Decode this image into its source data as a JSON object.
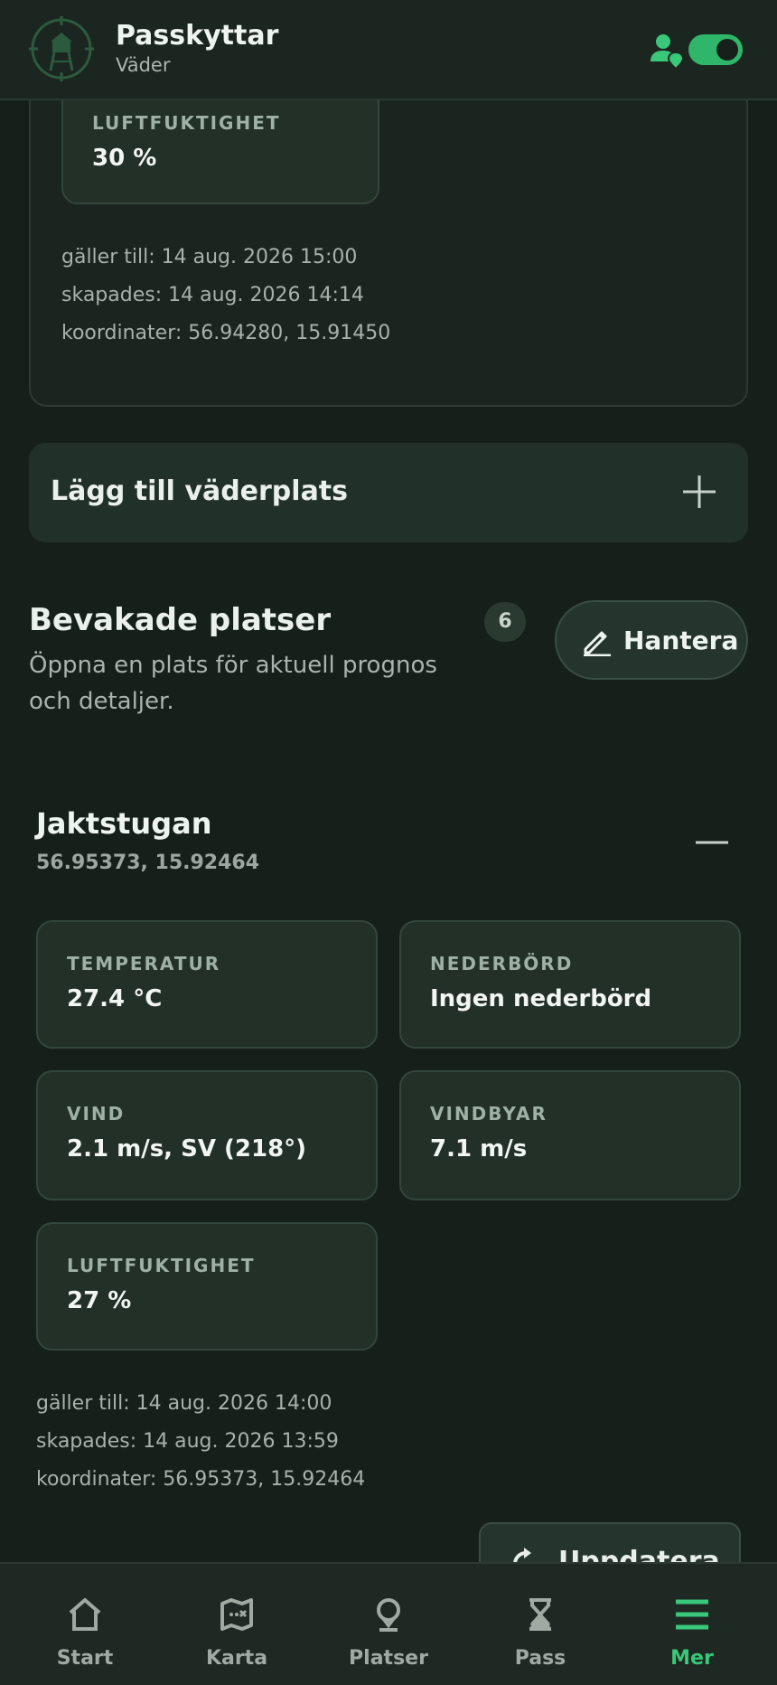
{
  "header": {
    "title": "Passkyttar",
    "subtitle": "Väder",
    "toggle_on": true,
    "user_icon": "user-location-icon"
  },
  "top_card": {
    "tiles": [
      {
        "label": "LUFTFUKTIGHET",
        "value": "30 %"
      }
    ],
    "valid_until": "gäller till: 14 aug. 2026 15:00",
    "created": "skapades: 14 aug. 2026 14:14",
    "coordinates": "koordinater: 56.94280, 15.91450"
  },
  "add_location": {
    "label": "Lägg till väderplats",
    "icon": "plus-icon"
  },
  "watched": {
    "title": "Bevakade platser",
    "description": "Öppna en plats för aktuell prognos och detaljer.",
    "count": "6",
    "manage_label": "Hantera"
  },
  "place": {
    "name": "Jaktstugan",
    "coords": "56.95373, 15.92464",
    "tiles": [
      {
        "label": "TEMPERATUR",
        "value": "27.4 °C"
      },
      {
        "label": "NEDERBÖRD",
        "value": "Ingen nederbörd"
      },
      {
        "label": "VIND",
        "value": "2.1 m/s, SV (218°)"
      },
      {
        "label": "VINDBYAR",
        "value": "7.1 m/s"
      },
      {
        "label": "LUFTFUKTIGHET",
        "value": "27 %"
      }
    ],
    "valid_until": "gäller till: 14 aug. 2026 14:00",
    "created": "skapades: 14 aug. 2026 13:59",
    "coordinates": "koordinater: 56.95373, 15.92464",
    "update_label": "Uppdatera"
  },
  "nav": [
    {
      "label": "Start",
      "icon": "home-icon"
    },
    {
      "label": "Karta",
      "icon": "map-icon"
    },
    {
      "label": "Platser",
      "icon": "location-pin-icon"
    },
    {
      "label": "Pass",
      "icon": "hourglass-icon"
    },
    {
      "label": "Mer",
      "icon": "menu-icon",
      "active": true
    }
  ],
  "colors": {
    "accent": "#39c77a",
    "background": "#16201b",
    "card": "#223028"
  }
}
